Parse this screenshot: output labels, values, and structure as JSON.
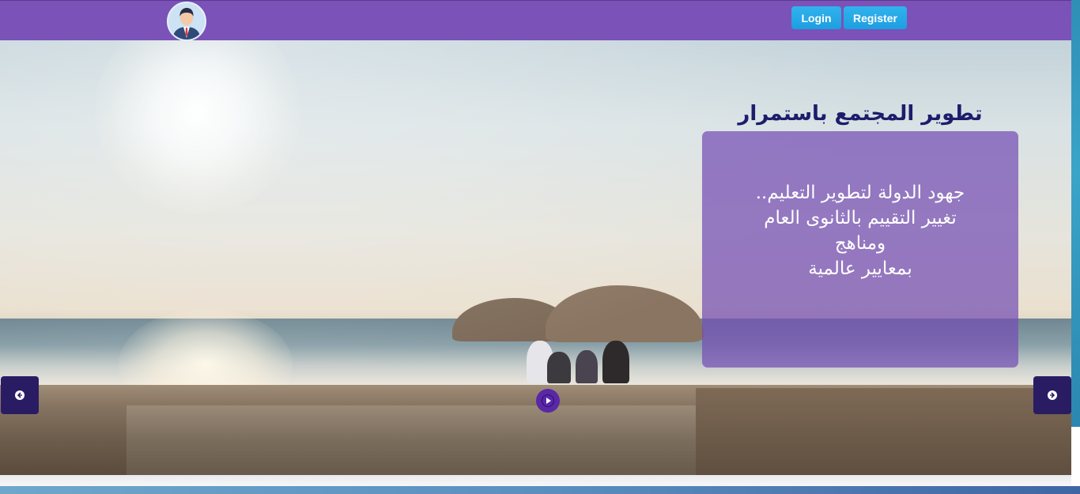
{
  "header": {
    "avatar_icon": "user-avatar-icon",
    "login_label": "Login",
    "register_label": "Register",
    "background_color": "#7a52b8",
    "button_color": "#1d9ee0"
  },
  "slider": {
    "title": "تطوير المجتمع باستمرار",
    "caption_lines": [
      "جهود الدولة لتطوير التعليم..",
      "تغيير التقييم بالثانوى العام",
      "ومناهج",
      "بمعايير عالمية"
    ],
    "prev_icon": "arrow-left-circle-icon",
    "next_icon": "arrow-right-circle-icon",
    "play_icon": "play-circle-icon",
    "caption_color": "#744eb4",
    "nav_color": "#2a1c63"
  }
}
